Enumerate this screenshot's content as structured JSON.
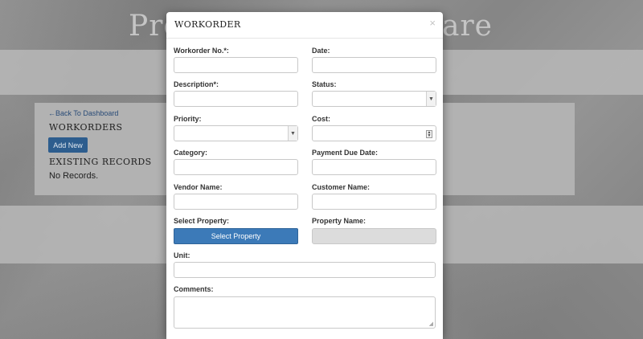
{
  "background": {
    "site_title_left": "Pro",
    "site_title_right": "are",
    "back_link": "←Back To Dashboard",
    "workorders_heading": "WORKORDERS",
    "add_new_label": "Add New",
    "existing_heading": "EXISTING RECORDS",
    "no_records": "No Records."
  },
  "modal": {
    "title": "WORKORDER",
    "close_label": "×",
    "fields": {
      "workorder_no": {
        "label": "Workorder No.*:",
        "value": ""
      },
      "date": {
        "label": "Date:",
        "value": ""
      },
      "description": {
        "label": "Description*:",
        "value": ""
      },
      "status": {
        "label": "Status:",
        "value": ""
      },
      "priority": {
        "label": "Priority:",
        "value": ""
      },
      "cost": {
        "label": "Cost:",
        "value": ""
      },
      "category": {
        "label": "Category:",
        "value": ""
      },
      "payment_due_date": {
        "label": "Payment Due Date:",
        "value": ""
      },
      "vendor_name": {
        "label": "Vendor Name:",
        "value": ""
      },
      "customer_name": {
        "label": "Customer Name:",
        "value": ""
      },
      "select_property": {
        "label": "Select Property:",
        "button_label": "Select Property"
      },
      "property_name": {
        "label": "Property Name:",
        "value": ""
      },
      "unit": {
        "label": "Unit:",
        "value": ""
      },
      "comments": {
        "label": "Comments:",
        "value": ""
      }
    }
  },
  "colors": {
    "primary_button": "#3c7ab8",
    "dark_button": "#2e5f91",
    "link": "#2a4d7a"
  }
}
